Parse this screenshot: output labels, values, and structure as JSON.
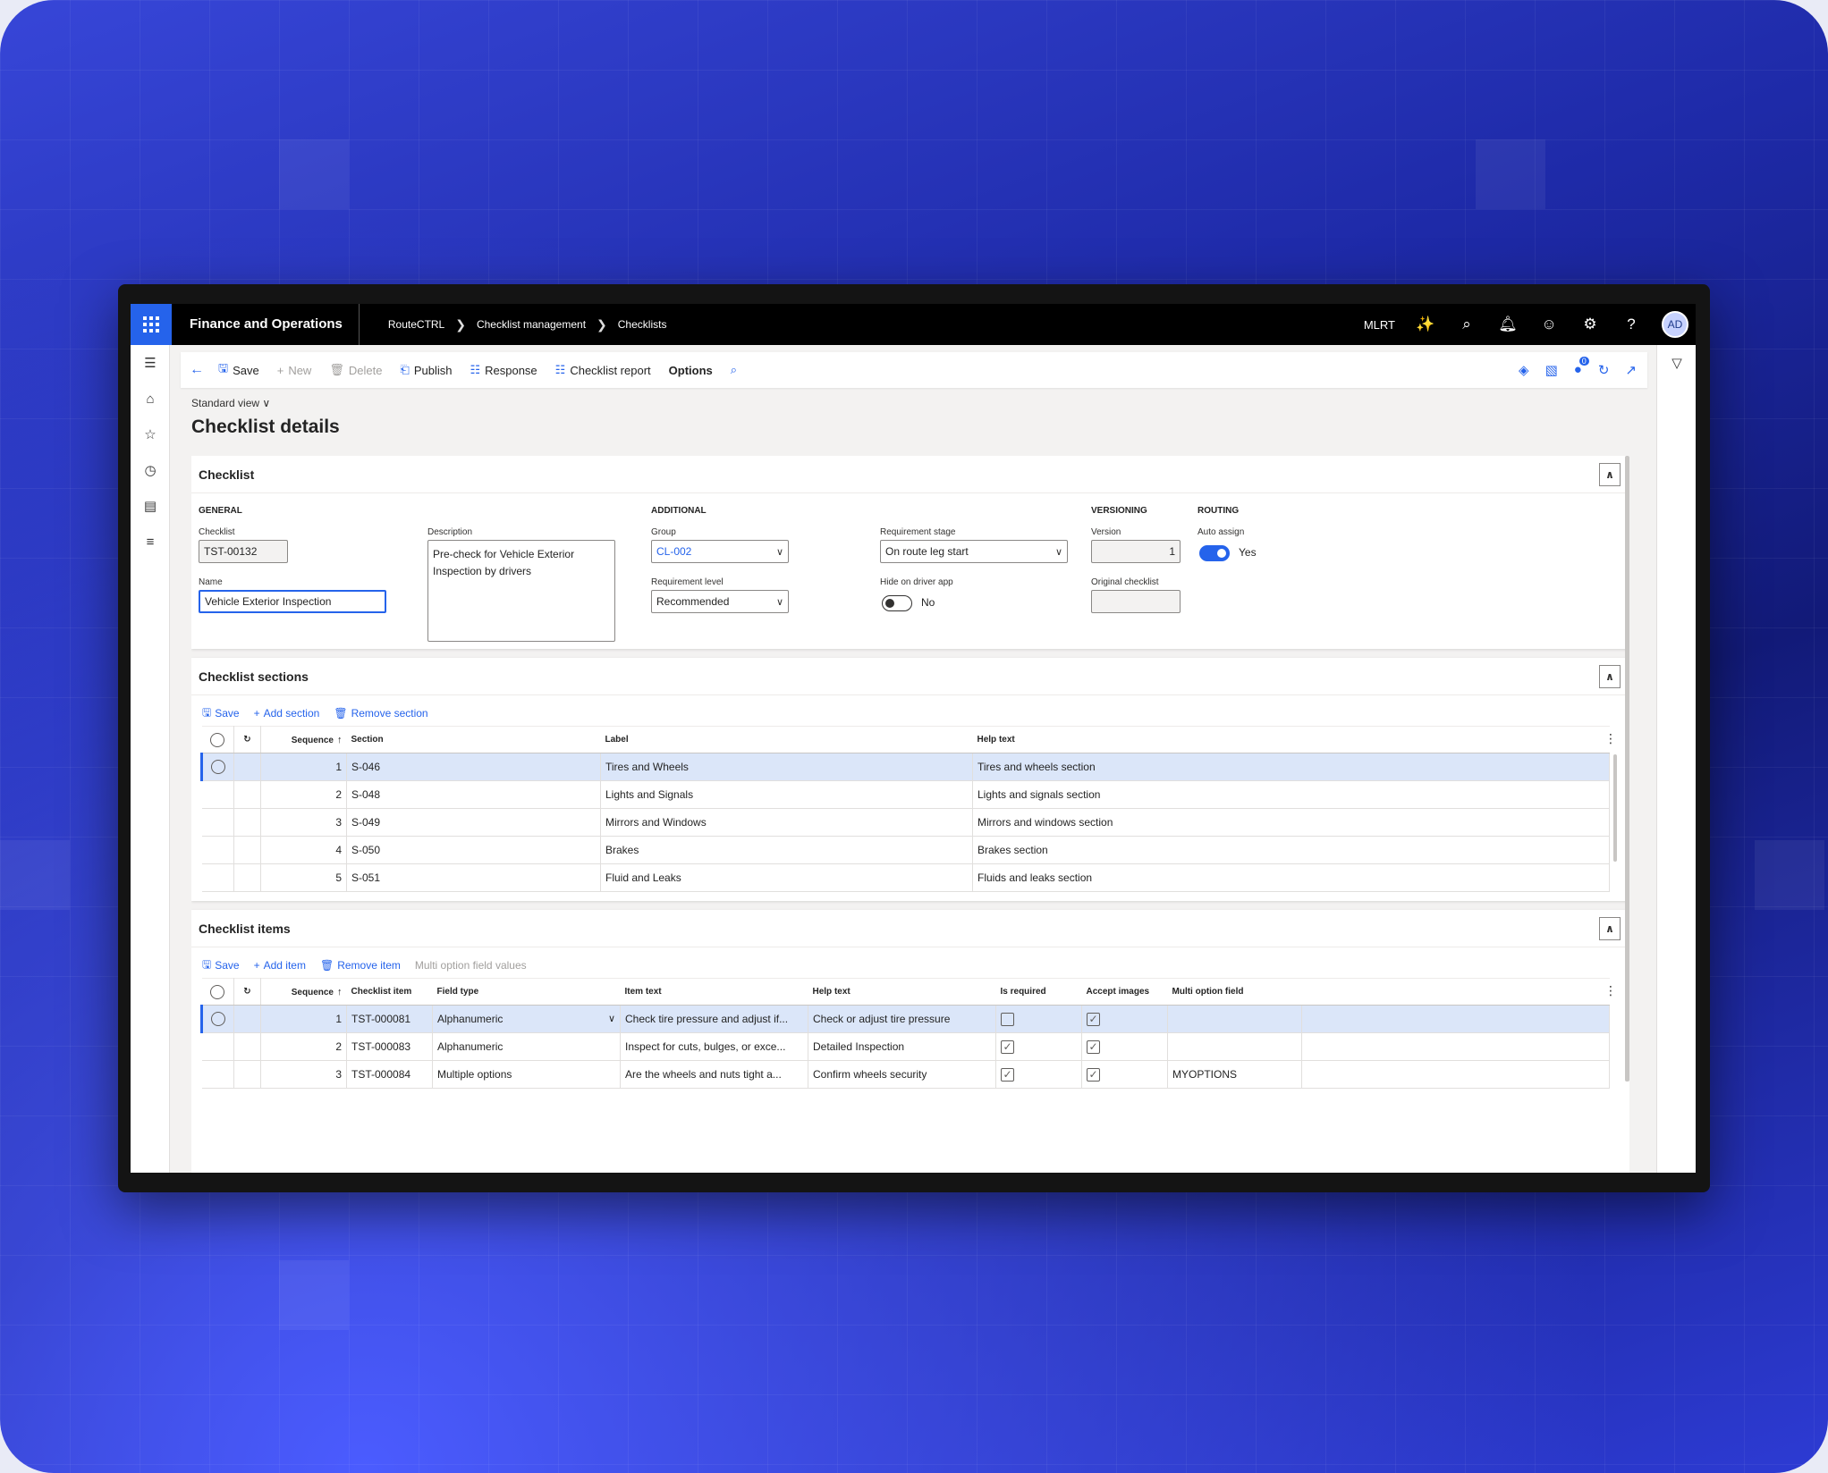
{
  "topbar": {
    "app_title": "Finance and Operations",
    "breadcrumbs": [
      "RouteCTRL",
      "Checklist management",
      "Checklists"
    ],
    "company": "MLRT",
    "avatar_initials": "AD"
  },
  "action_pane": {
    "save": "Save",
    "new": "New",
    "delete": "Delete",
    "publish": "Publish",
    "response": "Response",
    "checklist_report": "Checklist report",
    "options": "Options",
    "badge_count": "0"
  },
  "page": {
    "view": "Standard view",
    "title": "Checklist details"
  },
  "checklist": {
    "header": "Checklist",
    "general_title": "GENERAL",
    "checklist_label": "Checklist",
    "checklist_value": "TST-00132",
    "name_label": "Name",
    "name_value": "Vehicle Exterior Inspection",
    "description_label": "Description",
    "description_value": "Pre-check for Vehicle Exterior Inspection by drivers",
    "additional_title": "ADDITIONAL",
    "group_label": "Group",
    "group_value": "CL-002",
    "req_level_label": "Requirement level",
    "req_level_value": "Recommended",
    "req_stage_label": "Requirement stage",
    "req_stage_value": "On route leg start",
    "hide_label": "Hide on driver app",
    "hide_value": "No",
    "versioning_title": "VERSIONING",
    "version_label": "Version",
    "version_value": "1",
    "original_label": "Original checklist",
    "original_value": "",
    "routing_title": "ROUTING",
    "auto_assign_label": "Auto assign",
    "auto_assign_value": "Yes"
  },
  "sections": {
    "header": "Checklist sections",
    "toolbar": {
      "save": "Save",
      "add": "Add section",
      "remove": "Remove section"
    },
    "columns": {
      "sequence": "Sequence",
      "section": "Section",
      "label": "Label",
      "help": "Help text"
    },
    "rows": [
      {
        "sequence": "1",
        "section": "S-046",
        "label": "Tires and Wheels",
        "help": "Tires and wheels section"
      },
      {
        "sequence": "2",
        "section": "S-048",
        "label": "Lights and Signals",
        "help": "Lights and signals section"
      },
      {
        "sequence": "3",
        "section": "S-049",
        "label": "Mirrors and Windows",
        "help": "Mirrors and windows section"
      },
      {
        "sequence": "4",
        "section": "S-050",
        "label": "Brakes",
        "help": "Brakes section"
      },
      {
        "sequence": "5",
        "section": "S-051",
        "label": "Fluid and Leaks",
        "help": "Fluids and leaks section"
      }
    ]
  },
  "items": {
    "header": "Checklist items",
    "toolbar": {
      "save": "Save",
      "add": "Add item",
      "remove": "Remove item",
      "multi": "Multi option field values"
    },
    "columns": {
      "sequence": "Sequence",
      "item": "Checklist item",
      "field_type": "Field type",
      "item_text": "Item text",
      "help": "Help text",
      "required": "Is required",
      "images": "Accept images",
      "multi": "Multi option field"
    },
    "rows": [
      {
        "sequence": "1",
        "item": "TST-000081",
        "field_type": "Alphanumeric",
        "item_text": "Check tire pressure and adjust if...",
        "help": "Check or adjust tire pressure",
        "required": false,
        "images": true,
        "multi": ""
      },
      {
        "sequence": "2",
        "item": "TST-000083",
        "field_type": "Alphanumeric",
        "item_text": "Inspect for cuts, bulges, or exce...",
        "help": "Detailed Inspection",
        "required": true,
        "images": true,
        "multi": ""
      },
      {
        "sequence": "3",
        "item": "TST-000084",
        "field_type": "Multiple options",
        "item_text": "Are the wheels and nuts tight a...",
        "help": "Confirm wheels security",
        "required": true,
        "images": true,
        "multi": "MYOPTIONS"
      }
    ]
  },
  "colors": {
    "accent": "#2563eb",
    "topbar": "#000000",
    "selected_row": "#dbe6f9"
  }
}
